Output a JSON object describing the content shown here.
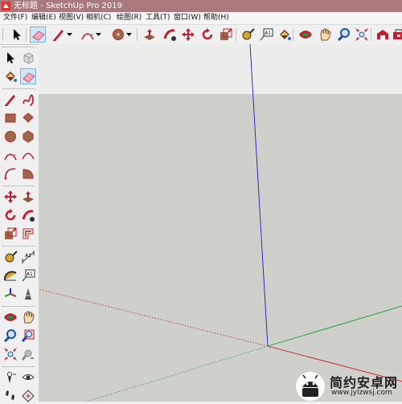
{
  "window": {
    "title": "无标题 - SketchUp Pro 2019"
  },
  "menu": [
    {
      "label": "文件(F)"
    },
    {
      "label": "编辑(E)"
    },
    {
      "label": "视图(V)"
    },
    {
      "label": "相机(C)"
    },
    {
      "label": "绘图(R)"
    },
    {
      "label": "工具(T)"
    },
    {
      "label": "窗口(W)"
    },
    {
      "label": "帮助(H)"
    }
  ],
  "toolbar": {
    "buttons": [
      {
        "icon": "select-icon",
        "active": false
      },
      {
        "icon": "eraser-icon",
        "active": true
      },
      {
        "icon": "pencil-line-icon",
        "active": false,
        "dropdown": true
      },
      {
        "icon": "arc-icon",
        "active": false,
        "dropdown": true
      },
      {
        "icon": "circle-shape-icon",
        "active": false,
        "dropdown": true
      },
      {
        "icon": "push-pull-icon",
        "active": false
      },
      {
        "icon": "follow-me-icon",
        "active": false
      },
      {
        "icon": "move-icon",
        "active": false
      },
      {
        "icon": "rotate-icon",
        "active": false
      },
      {
        "icon": "scale-icon",
        "active": false
      },
      {
        "icon": "tape-measure-icon",
        "active": false
      },
      {
        "icon": "text-icon",
        "active": false
      },
      {
        "icon": "paint-bucket-icon",
        "active": false
      },
      {
        "icon": "orbit-icon",
        "active": false
      },
      {
        "icon": "pan-icon",
        "active": false
      },
      {
        "icon": "zoom-icon",
        "active": false
      },
      {
        "icon": "zoom-extents-icon",
        "active": false
      },
      {
        "icon": "warehouse-icon",
        "active": false
      },
      {
        "icon": "extension-icon",
        "active": false
      }
    ]
  },
  "sidebar": {
    "groups": [
      [
        [
          "select-icon",
          "component-icon"
        ],
        [
          "paint-bucket-icon",
          "eraser-icon"
        ]
      ],
      [
        [
          "line-icon",
          "freehand-icon"
        ],
        [
          "rectangle-icon",
          "rotated-rectangle-icon"
        ],
        [
          "circle-icon",
          "polygon-icon"
        ],
        [
          "arc-icon",
          "two-point-arc-icon"
        ],
        [
          "three-point-arc-icon",
          "pie-icon"
        ]
      ],
      [
        [
          "move-icon",
          "push-pull-icon"
        ],
        [
          "rotate-icon",
          "follow-me-icon"
        ],
        [
          "scale-icon",
          "offset-icon"
        ]
      ],
      [
        [
          "tape-measure-icon",
          "dimension-icon"
        ],
        [
          "protractor-icon",
          "text-icon"
        ],
        [
          "axes-icon",
          "3d-text-icon"
        ]
      ],
      [
        [
          "orbit-icon",
          "pan-icon"
        ],
        [
          "zoom-icon",
          "zoom-window-icon"
        ],
        [
          "zoom-extents-icon",
          "previous-view-icon"
        ]
      ],
      [
        [
          "position-camera-icon",
          "look-around-icon"
        ],
        [
          "walk-icon",
          "section-plane-icon"
        ]
      ]
    ],
    "active": "eraser-icon"
  },
  "canvas": {
    "sky_color": "#ededec",
    "ground_color": "#cfcfcc",
    "axis_colors": {
      "x": "#c02020",
      "y": "#20a020",
      "z": "#2020c0"
    }
  },
  "watermark": {
    "text": "简约安卓网",
    "url": "www.jylzwsj.com"
  }
}
